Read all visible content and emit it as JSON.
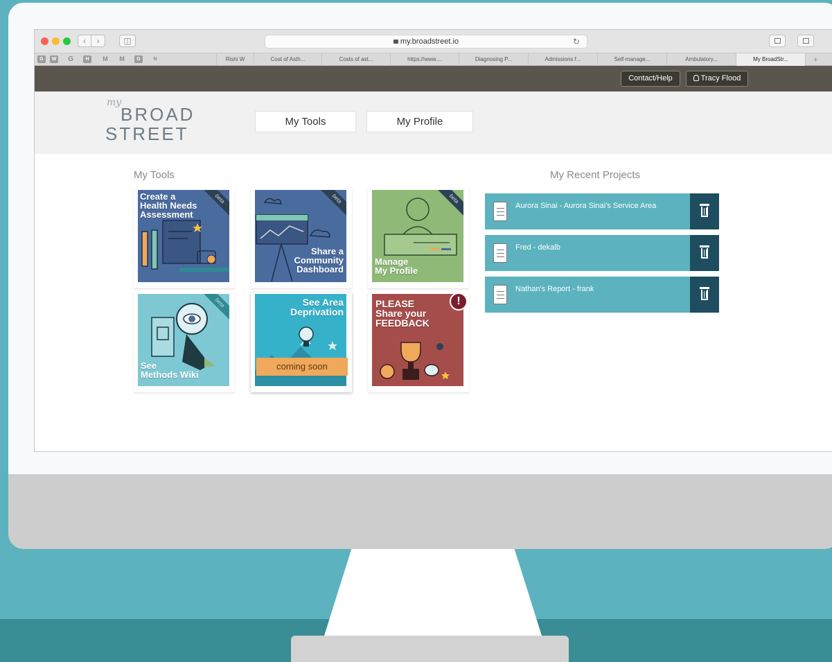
{
  "browser": {
    "url": "my.broadstreet.io",
    "favicons": [
      "G",
      "W",
      "G",
      "H",
      "M",
      "M",
      "G",
      "N"
    ],
    "tabs": [
      {
        "label": "Rishi W",
        "active": false
      },
      {
        "label": "Cost of Asth...",
        "active": false
      },
      {
        "label": "Costs of ast...",
        "active": false
      },
      {
        "label": "https://www....",
        "active": false
      },
      {
        "label": "Diagnosing P...",
        "active": false
      },
      {
        "label": "Admissions f...",
        "active": false
      },
      {
        "label": "Self-manage...",
        "active": false
      },
      {
        "label": "Ambulatory...",
        "active": false
      },
      {
        "label": "My BroadStr...",
        "active": true
      }
    ],
    "new_tab": "+"
  },
  "topbar": {
    "contact_label": "Contact/Help",
    "user_name": "Tracy Flood"
  },
  "logo": {
    "my": "my",
    "line1": "BROAD",
    "line2": "STREET"
  },
  "nav": {
    "tools": "My Tools",
    "profile": "My Profile"
  },
  "tools_section": {
    "title": "My Tools",
    "tools": [
      {
        "label": "Create a\nHealth Needs\nAssessment",
        "badge": "beta",
        "color": "#4a6b9e"
      },
      {
        "label": "Share a\nCommunity\nDashboard",
        "badge": "beta",
        "color": "#4a6b9e"
      },
      {
        "label": "Manage\nMy Profile",
        "badge": "beta",
        "color": "#8fb977"
      },
      {
        "label": "See\nMethods Wiki",
        "badge": "beta",
        "color": "#7ec8d4"
      },
      {
        "label": "See Area\nDeprivation",
        "banner": "coming soon",
        "color": "#35b1c9"
      },
      {
        "label": "PLEASE\nShare your\nFEEDBACK",
        "alert": "!",
        "color": "#a54d4b"
      }
    ]
  },
  "projects_section": {
    "title": "My Recent Projects",
    "projects": [
      {
        "name": "Aurora Sinai - Aurora Sinai's Service Area"
      },
      {
        "name": "Fred - dekalb"
      },
      {
        "name": "Nathan's Report - frank"
      }
    ]
  },
  "icons": [
    "back-icon",
    "forward-icon",
    "sidebar-icon",
    "lock-icon",
    "reload-icon",
    "share-icon",
    "tabs-icon",
    "user-icon",
    "document-icon",
    "trash-icon"
  ]
}
